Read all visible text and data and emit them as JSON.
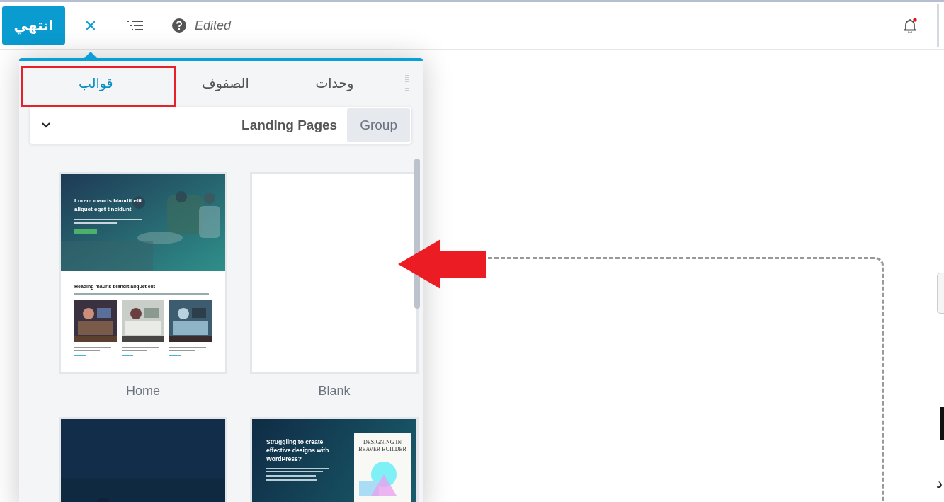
{
  "toolbar": {
    "done_button": "انتهي",
    "status": "Edited",
    "notifications": {
      "unread": true
    }
  },
  "panel": {
    "tabs": [
      {
        "label": "وحدات",
        "selected": false
      },
      {
        "label": "الصفوف",
        "selected": false
      },
      {
        "label": "قوالب",
        "selected": true
      }
    ],
    "group_select": {
      "label": "Group",
      "value": "Landing Pages"
    },
    "templates": [
      {
        "kind": "landing",
        "name": "Home",
        "heading": "Lorem mauris blandit elit aliquet eget tincidunt",
        "subheading": "Heading mauris blandit aliquet elit"
      },
      {
        "kind": "blank",
        "name": "Blank"
      },
      {
        "kind": "dark"
      },
      {
        "kind": "promo",
        "heading": "Struggling to create effective designs with WordPress?",
        "book_title": "DESIGNING IN BEAVER BUILDER"
      }
    ]
  },
  "page_edge_text": "د"
}
